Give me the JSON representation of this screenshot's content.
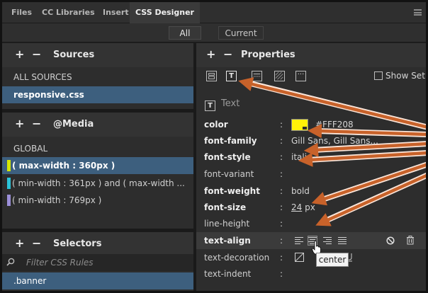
{
  "tabs": [
    {
      "label": "Files",
      "active": false
    },
    {
      "label": "CC Libraries",
      "active": false
    },
    {
      "label": "Insert",
      "active": false
    },
    {
      "label": "CSS Designer",
      "active": true
    }
  ],
  "view_toggle": {
    "all": "All",
    "current": "Current",
    "selected": "All"
  },
  "sources": {
    "title": "Sources",
    "items": [
      {
        "label": "ALL SOURCES",
        "selected": false
      },
      {
        "label": "responsive.css",
        "selected": true
      }
    ]
  },
  "media": {
    "title": "@Media",
    "items": [
      {
        "label": "GLOBAL",
        "selected": false
      },
      {
        "label": "( max-width : 360px )",
        "selected": true,
        "marker_color": "#d4e600"
      },
      {
        "label": "( min-width : 361px ) and ( max-width ...",
        "selected": false,
        "marker_color": "#2bc3d8"
      },
      {
        "label": "( min-width : 769px )",
        "selected": false,
        "marker_color": "#9b8fd8"
      }
    ]
  },
  "selectors": {
    "title": "Selectors",
    "filter_placeholder": "Filter CSS Rules",
    "items": [
      {
        "label": ".banner",
        "selected": true
      }
    ]
  },
  "properties": {
    "title": "Properties",
    "show_set_label": "Show Set",
    "category_icons": [
      "layout-icon",
      "text-icon",
      "border-icon",
      "background-icon",
      "more-icon"
    ],
    "section_label": "Text",
    "rows": [
      {
        "name": "color",
        "bold": true,
        "value": "#FFF208",
        "swatch": "#FFF208"
      },
      {
        "name": "font-family",
        "bold": true,
        "value": "Gill Sans, Gill Sans..."
      },
      {
        "name": "font-style",
        "bold": true,
        "value": "italic"
      },
      {
        "name": "font-variant",
        "bold": false,
        "value": ""
      },
      {
        "name": "font-weight",
        "bold": true,
        "value": "bold"
      },
      {
        "name": "font-size",
        "bold": true,
        "value_num": "24",
        "value_unit": "px"
      },
      {
        "name": "line-height",
        "bold": false,
        "value": ""
      },
      {
        "name": "text-align",
        "bold": true,
        "value": "center",
        "options": [
          "left",
          "center",
          "right",
          "justify"
        ]
      },
      {
        "name": "text-decoration",
        "bold": false,
        "value": ""
      },
      {
        "name": "text-indent",
        "bold": false,
        "value": ""
      }
    ]
  },
  "tooltip": "center",
  "colors": {
    "accent_selection": "#3d5f7e",
    "annotation_arrow": "#c8622a"
  }
}
